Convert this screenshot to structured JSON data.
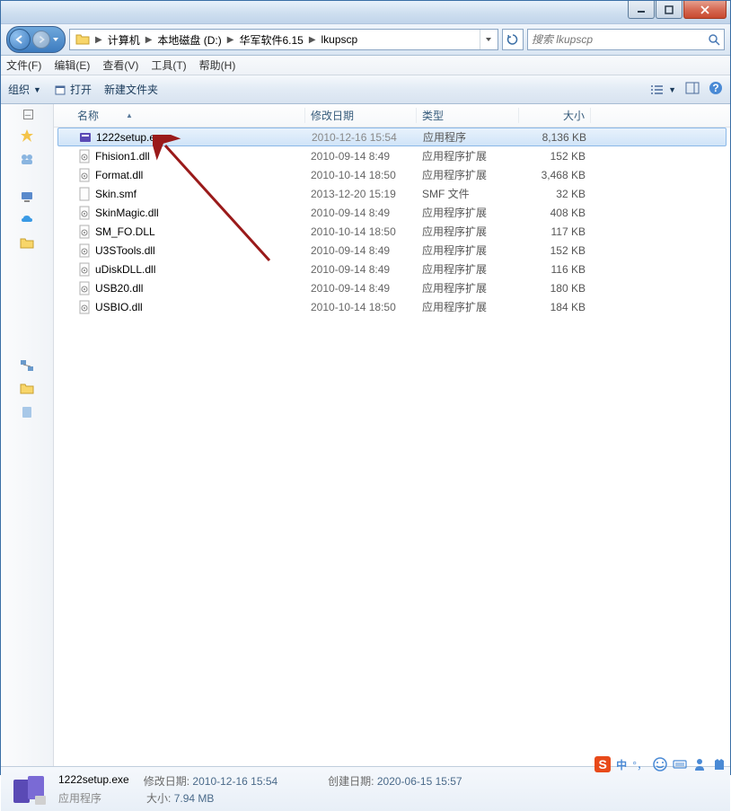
{
  "titlebar": {},
  "nav": {},
  "breadcrumbs": [
    "计算机",
    "本地磁盘 (D:)",
    "华军软件6.15",
    "lkupscp"
  ],
  "search": {
    "placeholder": "搜索 lkupscp"
  },
  "menubar": {
    "file": "文件(F)",
    "edit": "编辑(E)",
    "view": "查看(V)",
    "tools": "工具(T)",
    "help": "帮助(H)"
  },
  "toolbar": {
    "organize": "组织",
    "open": "打开",
    "newfolder": "新建文件夹"
  },
  "columns": {
    "name": "名称",
    "date": "修改日期",
    "type": "类型",
    "size": "大小"
  },
  "files": [
    {
      "name": "1222setup.exe",
      "date": "2010-12-16 15:54",
      "type": "应用程序",
      "size": "8,136 KB",
      "icon": "exe",
      "selected": true
    },
    {
      "name": "Fhision1.dll",
      "date": "2010-09-14 8:49",
      "type": "应用程序扩展",
      "size": "152 KB",
      "icon": "dll"
    },
    {
      "name": "Format.dll",
      "date": "2010-10-14 18:50",
      "type": "应用程序扩展",
      "size": "3,468 KB",
      "icon": "dll"
    },
    {
      "name": "Skin.smf",
      "date": "2013-12-20 15:19",
      "type": "SMF 文件",
      "size": "32 KB",
      "icon": "file"
    },
    {
      "name": "SkinMagic.dll",
      "date": "2010-09-14 8:49",
      "type": "应用程序扩展",
      "size": "408 KB",
      "icon": "dll"
    },
    {
      "name": "SM_FO.DLL",
      "date": "2010-10-14 18:50",
      "type": "应用程序扩展",
      "size": "117 KB",
      "icon": "dll"
    },
    {
      "name": "U3STools.dll",
      "date": "2010-09-14 8:49",
      "type": "应用程序扩展",
      "size": "152 KB",
      "icon": "dll"
    },
    {
      "name": "uDiskDLL.dll",
      "date": "2010-09-14 8:49",
      "type": "应用程序扩展",
      "size": "116 KB",
      "icon": "dll"
    },
    {
      "name": "USB20.dll",
      "date": "2010-09-14 8:49",
      "type": "应用程序扩展",
      "size": "180 KB",
      "icon": "dll"
    },
    {
      "name": "USBIO.dll",
      "date": "2010-10-14 18:50",
      "type": "应用程序扩展",
      "size": "184 KB",
      "icon": "dll"
    }
  ],
  "status": {
    "filename": "1222setup.exe",
    "mod_label": "修改日期:",
    "mod_value": "2010-12-16 15:54",
    "create_label": "创建日期:",
    "create_value": "2020-06-15 15:57",
    "type_label": "应用程序",
    "size_label": "大小:",
    "size_value": "7.94 MB"
  },
  "ime": {
    "lang": "中"
  }
}
